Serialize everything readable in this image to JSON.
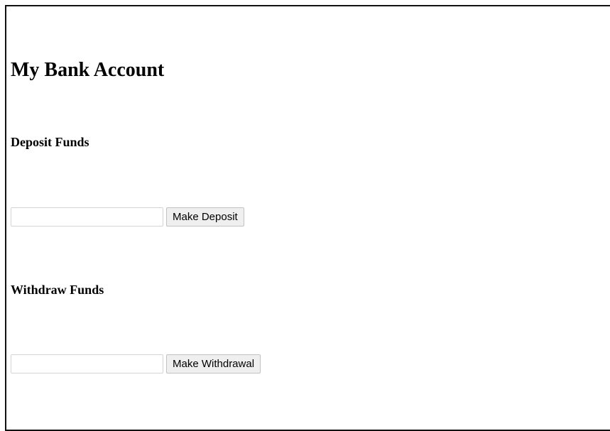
{
  "page": {
    "title": "My Bank Account"
  },
  "deposit": {
    "heading": "Deposit Funds",
    "input_value": "",
    "input_placeholder": "",
    "button_label": "Make Deposit"
  },
  "withdraw": {
    "heading": "Withdraw Funds",
    "input_value": "",
    "input_placeholder": "",
    "button_label": "Make Withdrawal"
  }
}
